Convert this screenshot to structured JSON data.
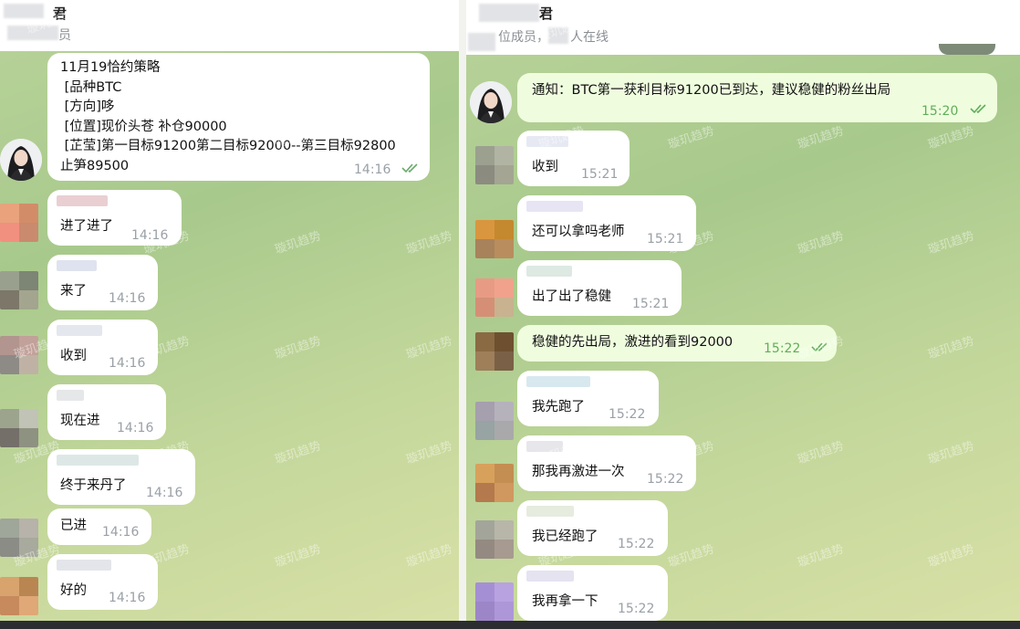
{
  "left": {
    "header": {
      "title": "君",
      "subtitle": "员"
    },
    "strategy": {
      "lines": [
        "11月19恰约策略",
        " [品种BTC",
        " [方向]哆",
        " [位置]现价头苍 补仓90000",
        " [芷莹]第一目标91200第二目标92000--第三目标92800",
        "止笋89500"
      ],
      "time": "14:16"
    },
    "messages": [
      {
        "text": "进了进了",
        "time": "14:16"
      },
      {
        "text": "来了",
        "time": "14:16"
      },
      {
        "text": "收到",
        "time": "14:16"
      },
      {
        "text": "现在进",
        "time": "14:16"
      },
      {
        "text": "终于来丹了",
        "time": "14:16"
      },
      {
        "text": "已进",
        "time": "14:16"
      },
      {
        "text": "好的",
        "time": "14:16"
      }
    ]
  },
  "right": {
    "header": {
      "title": "君",
      "subtitle_a": "位成员，",
      "subtitle_b": "人在线"
    },
    "notice": {
      "text": "通知：BTC第一获利目标91200已到达，建议稳健的粉丝出局",
      "time": "15:20"
    },
    "messages": [
      {
        "text": "收到",
        "time": "15:21"
      },
      {
        "text": "还可以拿吗老师",
        "time": "15:21"
      },
      {
        "text": "出了出了稳健",
        "time": "15:21"
      },
      {
        "text": "稳健的先出局，激进的看到92000",
        "time": "15:22"
      },
      {
        "text": "我先跑了",
        "time": "15:22"
      },
      {
        "text": "那我再激进一次",
        "time": "15:22"
      },
      {
        "text": "我已经跑了",
        "time": "15:22"
      },
      {
        "text": "我再拿一下",
        "time": "15:22"
      }
    ]
  },
  "watermark": "璇玑趋势",
  "colors": {
    "own_bubble": "#effdde",
    "incoming_bubble": "#ffffff",
    "read_check": "#5fae5a",
    "time_grey": "#9aa0a6"
  },
  "icons": {
    "read_receipt": "double-check-icon",
    "user_avatar": "woman-portrait-avatar"
  }
}
